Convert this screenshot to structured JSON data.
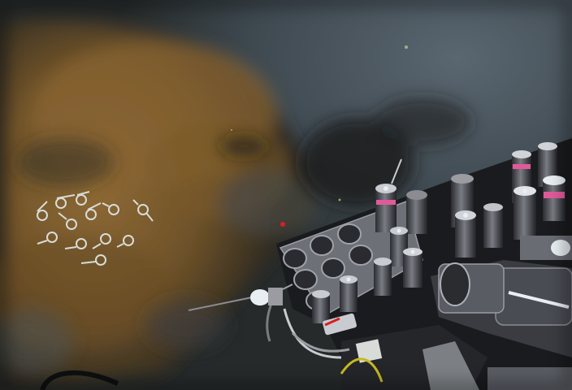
{
  "scene": {
    "colors": {
      "sediment_dark": "#2b2a22",
      "microbial_mat": "#8a6532",
      "mat_light": "#a67a3c",
      "blue_gray_sediment": "#46525a",
      "equipment_gray": "#7d8088",
      "equipment_dark": "#303238",
      "marker_magenta": "#e05a9a",
      "highlight": "#e8eef2",
      "cable_yellow": "#c8b820",
      "red_light": "#d82020"
    }
  }
}
